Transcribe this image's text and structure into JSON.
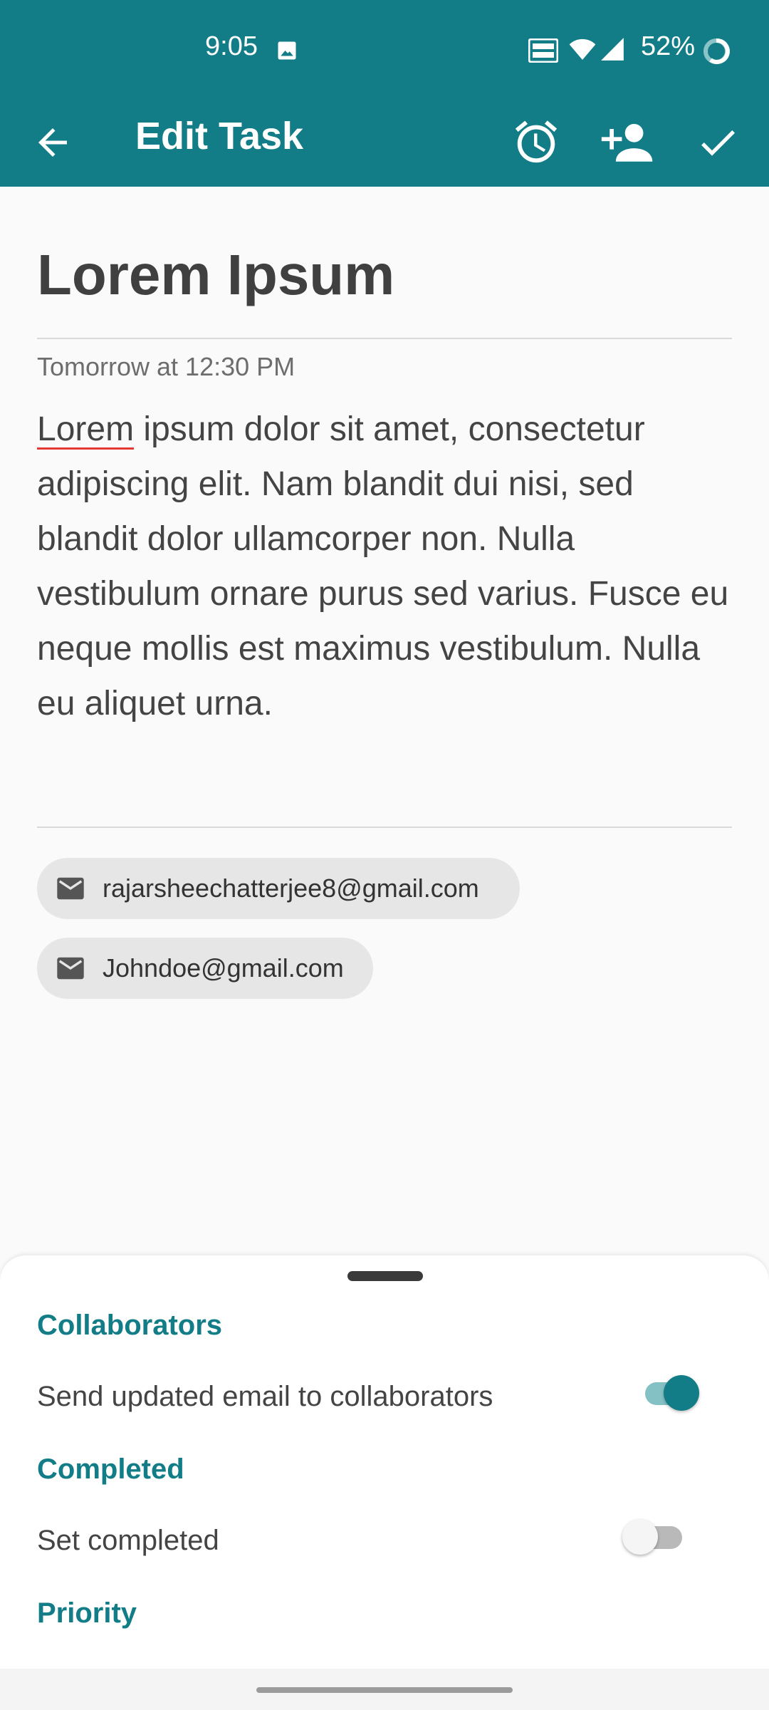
{
  "status_bar": {
    "time": "9:05",
    "battery": "52%",
    "icons": [
      "image-icon",
      "volte-icon",
      "wifi-icon",
      "signal-icon",
      "battery-icon"
    ]
  },
  "app_bar": {
    "title": "Edit Task",
    "actions": [
      "back-arrow-icon",
      "alarm-icon",
      "add-person-icon",
      "check-icon"
    ]
  },
  "task": {
    "title": "Lorem Ipsum",
    "due": "Tomorrow at 12:30 PM",
    "body_first_word": "Lorem",
    "body_rest": " ipsum dolor sit amet, consectetur adipiscing elit. Nam blandit dui nisi, sed blandit dolor ullamcorper non. Nulla vestibulum ornare purus sed varius. Fusce eu neque mollis est maximus vestibulum. Nulla eu aliquet urna."
  },
  "collaborators_chips": [
    {
      "email": "rajarsheechatterjee8@gmail.com"
    },
    {
      "email": "Johndoe@gmail.com"
    }
  ],
  "sheet": {
    "collaborators_title": "Collaborators",
    "send_email_label": "Send updated email to collaborators",
    "send_email_on": true,
    "completed_title": "Completed",
    "set_completed_label": "Set completed",
    "set_completed_on": false,
    "priority_title": "Priority"
  },
  "colors": {
    "primary": "#127d87",
    "toggle_track_on": "#84c1c5",
    "chip_bg": "#e6e6e6"
  }
}
